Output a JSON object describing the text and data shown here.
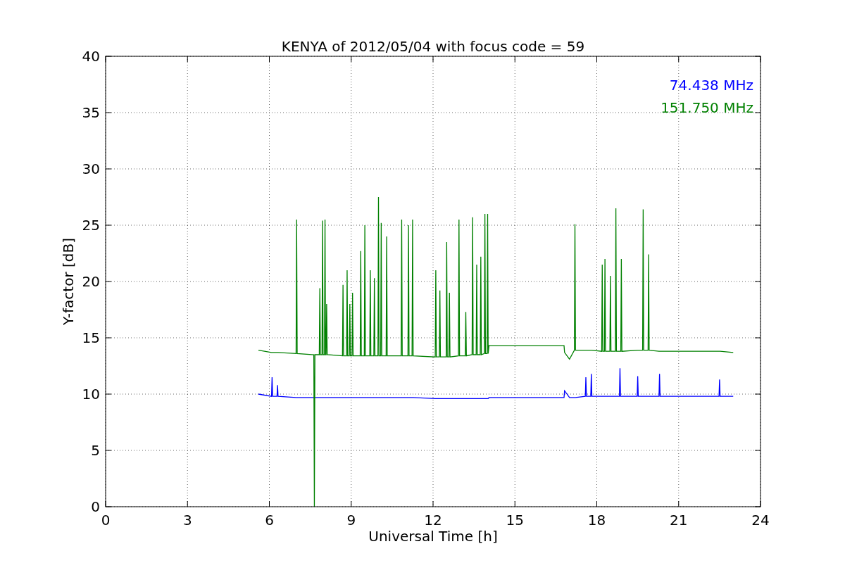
{
  "chart_data": {
    "type": "line",
    "title": "KENYA of 2012/05/04 with focus code = 59",
    "xlabel": "Universal Time [h]",
    "ylabel": "Y-factor [dB]",
    "xlim": [
      0,
      24
    ],
    "ylim": [
      0,
      40
    ],
    "xticks": [
      0,
      3,
      6,
      9,
      12,
      15,
      18,
      21,
      24
    ],
    "yticks": [
      0,
      5,
      10,
      15,
      20,
      25,
      30,
      35,
      40
    ],
    "grid": true,
    "x": [
      5.6,
      6.08,
      6.1,
      6.12,
      6.28,
      6.3,
      6.32,
      6.98,
      7.0,
      7.02,
      7.63,
      7.65,
      7.67,
      7.83,
      7.85,
      7.87,
      7.93,
      7.95,
      7.97,
      8.02,
      8.04,
      8.06,
      8.08,
      8.1,
      8.12,
      8.68,
      8.7,
      8.72,
      8.83,
      8.85,
      8.87,
      8.93,
      8.95,
      8.97,
      9.03,
      9.05,
      9.07,
      9.33,
      9.35,
      9.37,
      9.48,
      9.5,
      9.52,
      9.68,
      9.7,
      9.72,
      9.83,
      9.85,
      9.87,
      9.98,
      10.0,
      10.02,
      10.08,
      10.1,
      10.12,
      10.28,
      10.3,
      10.32,
      10.83,
      10.85,
      10.87,
      11.08,
      11.1,
      11.12,
      11.23,
      11.25,
      11.27,
      12.08,
      12.1,
      12.12,
      12.23,
      12.25,
      12.27,
      12.48,
      12.5,
      12.52,
      12.58,
      12.6,
      12.62,
      12.93,
      12.95,
      12.97,
      13.18,
      13.2,
      13.22,
      13.43,
      13.45,
      13.47,
      13.58,
      13.6,
      13.62,
      13.73,
      13.75,
      13.77,
      13.88,
      13.9,
      13.92,
      13.98,
      14.0,
      14.02,
      14.05,
      16.8,
      16.82,
      17.0,
      17.18,
      17.2,
      17.22,
      17.58,
      17.6,
      17.62,
      17.78,
      17.8,
      17.82,
      18.18,
      18.2,
      18.22,
      18.28,
      18.3,
      18.32,
      18.48,
      18.5,
      18.52,
      18.68,
      18.7,
      18.72,
      18.83,
      18.85,
      18.87,
      18.88,
      18.9,
      18.92,
      19.48,
      19.5,
      19.52,
      19.68,
      19.7,
      19.72,
      19.88,
      19.9,
      19.92,
      20.28,
      20.3,
      20.32,
      22.48,
      22.5,
      22.52,
      23.0
    ],
    "series": [
      {
        "name": "74.438 MHz",
        "color": "#0000ff",
        "values": [
          10.0,
          9.8,
          11.5,
          9.8,
          9.8,
          10.8,
          9.8,
          9.7,
          9.7,
          9.7,
          9.7,
          9.7,
          9.7,
          9.7,
          9.7,
          9.7,
          9.7,
          9.7,
          9.7,
          9.7,
          9.7,
          9.7,
          9.7,
          9.7,
          9.7,
          9.7,
          9.7,
          9.7,
          9.7,
          9.7,
          9.7,
          9.7,
          9.7,
          9.7,
          9.7,
          9.7,
          9.7,
          9.7,
          9.7,
          9.7,
          9.7,
          9.7,
          9.7,
          9.7,
          9.7,
          9.7,
          9.7,
          9.7,
          9.7,
          9.7,
          9.7,
          9.7,
          9.7,
          9.7,
          9.7,
          9.7,
          9.7,
          9.7,
          9.7,
          9.7,
          9.7,
          9.7,
          9.7,
          9.7,
          9.7,
          9.7,
          9.7,
          9.6,
          9.6,
          9.6,
          9.6,
          9.6,
          9.6,
          9.6,
          9.6,
          9.6,
          9.6,
          9.6,
          9.6,
          9.6,
          9.6,
          9.6,
          9.6,
          9.6,
          9.6,
          9.6,
          9.6,
          9.6,
          9.6,
          9.6,
          9.6,
          9.6,
          9.6,
          9.6,
          9.6,
          9.6,
          9.6,
          9.6,
          9.6,
          9.6,
          9.7,
          9.7,
          10.3,
          9.7,
          9.7,
          9.7,
          9.7,
          9.8,
          11.5,
          9.8,
          9.8,
          11.8,
          9.8,
          9.8,
          9.8,
          9.8,
          9.8,
          9.8,
          9.8,
          9.8,
          9.8,
          9.8,
          9.8,
          9.8,
          9.8,
          9.8,
          12.3,
          9.8,
          9.8,
          9.8,
          9.8,
          9.8,
          11.6,
          9.8,
          9.8,
          9.8,
          9.8,
          9.8,
          9.8,
          9.8,
          9.8,
          11.8,
          9.8,
          9.8,
          11.3,
          9.8,
          9.8
        ]
      },
      {
        "name": "151.750 MHz",
        "color": "#008000",
        "values": [
          13.9,
          13.7,
          13.7,
          13.7,
          13.7,
          13.7,
          13.7,
          13.6,
          25.5,
          13.6,
          13.5,
          0,
          13.5,
          13.5,
          19.4,
          13.5,
          13.5,
          25.4,
          13.5,
          13.5,
          25.5,
          13.5,
          13.5,
          18,
          13.5,
          13.4,
          19.7,
          13.4,
          13.4,
          21,
          13.4,
          13.4,
          18,
          13.4,
          13.4,
          19,
          13.4,
          13.4,
          22.7,
          13.4,
          13.4,
          25,
          13.4,
          13.4,
          21,
          13.4,
          13.4,
          20.3,
          13.4,
          13.4,
          27.5,
          13.4,
          13.4,
          25.2,
          13.4,
          13.4,
          24,
          13.4,
          13.4,
          25.5,
          13.4,
          13.4,
          25,
          13.4,
          13.4,
          25.5,
          13.4,
          13.3,
          21,
          13.3,
          13.3,
          19.2,
          13.3,
          13.3,
          23.5,
          13.3,
          13.3,
          19,
          13.3,
          13.4,
          25.5,
          13.4,
          13.4,
          17.3,
          13.4,
          13.5,
          25.7,
          13.5,
          13.5,
          21.5,
          13.5,
          13.5,
          22.2,
          13.5,
          13.6,
          26,
          13.6,
          13.6,
          26,
          13.6,
          14.3,
          14.3,
          13.7,
          13.1,
          13.9,
          25.1,
          13.9,
          13.9,
          13.9,
          13.9,
          13.9,
          13.9,
          13.9,
          13.8,
          21.5,
          13.8,
          13.8,
          22,
          13.8,
          13.8,
          20.5,
          13.8,
          13.8,
          26.5,
          13.8,
          13.8,
          13.8,
          13.8,
          13.8,
          22,
          13.8,
          13.9,
          13.9,
          13.9,
          13.9,
          26.4,
          13.9,
          13.9,
          22.4,
          13.9,
          13.8,
          13.8,
          13.8,
          13.8,
          13.8,
          13.8,
          13.7
        ]
      }
    ]
  }
}
